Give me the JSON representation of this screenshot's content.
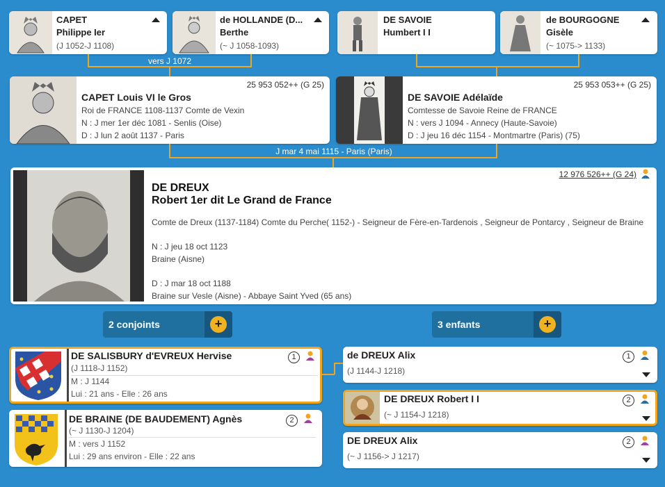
{
  "grandparents": [
    {
      "surname": "CAPET",
      "given": "Philippe Ier",
      "dates": "(J 1052-J 1108)",
      "portrait": "king-engraving-portrait"
    },
    {
      "surname": "de HOLLANDE (D...",
      "given": "Berthe",
      "dates": "(~ J 1058-1093)",
      "portrait": "queen-engraving-portrait"
    },
    {
      "surname": "DE SAVOIE",
      "given": "Humbert I I",
      "dates": "",
      "portrait": "knight-figure-portrait"
    },
    {
      "surname": "de BOURGOGNE",
      "given": "Gisèle",
      "dates": "(~ 1075-> 1133)",
      "portrait": "lady-figure-portrait"
    }
  ],
  "grandparents_marriage": "vers J 1072",
  "father": {
    "sosa": "25 953 052++ (G 25)",
    "name": "CAPET Louis VI le Gros",
    "titles": "Roi de FRANCE 1108-1137 Comte de Vexin",
    "birth": "N : J mer 1er déc 1081 - Senlis (Oise)",
    "death": "D : J lun 2 août 1137 - Paris"
  },
  "mother": {
    "sosa": "25 953 053++ (G 25)",
    "name": "DE SAVOIE Adélaïde",
    "titles": "Comtesse de Savoie Reine de FRANCE",
    "birth": "N : vers J 1094 - Annecy (Haute-Savoie)",
    "death": "D : J jeu 16 déc 1154 - Montmartre (Paris) (75)"
  },
  "parents_marriage": "J mar 4 mai 1115 - Paris (Paris)",
  "main": {
    "sosa": "12 976 526++ (G 24)",
    "surname": "DE DREUX",
    "given": "Robert 1er dit Le Grand de France",
    "titles": "Comte de Dreux (1137-1184) Comte du Perche( 1152-) - Seigneur de Fère-en-Tardenois , Seigneur de Pontarcy , Seigneur de Braine",
    "birth_date": "N : J jeu 18 oct 1123",
    "birth_place": "Braine (Aisne)",
    "death_date": "D : J mar 18 oct 1188",
    "death_place": "Braine sur Vesle (Aisne) - Abbaye Saint Yved (65 ans)"
  },
  "spouses_button": "2 conjoints",
  "children_button": "3 enfants",
  "spouses": [
    {
      "num": "1",
      "name": "DE SALISBURY d'EVREUX Hervise",
      "dates": "(J 1118-J 1152)",
      "marriage": "M : J 1144",
      "ages": "Lui : 21 ans - Elle : 26 ans"
    },
    {
      "num": "2",
      "name": "DE BRAINE (DE BAUDEMENT) Agnès",
      "dates": "(~ J 1130-J 1204)",
      "marriage": "M : vers J 1152",
      "ages": "Lui : 29 ans environ - Elle : 22 ans"
    }
  ],
  "children": [
    {
      "num": "1",
      "name": "de DREUX Alix",
      "dates": "(J 1144-J 1218)"
    },
    {
      "num": "2",
      "name": "DE DREUX Robert I I",
      "dates": "(~ J 1154-J 1218)"
    },
    {
      "num": "2",
      "name": "DE DREUX Alix",
      "dates": "(~ J 1156-> J 1217)"
    }
  ],
  "colors": {
    "background": "#2a8ccc",
    "accent": "#f0a51c",
    "male_icon": "#f0a51c",
    "female_icon": "#a040a0"
  }
}
